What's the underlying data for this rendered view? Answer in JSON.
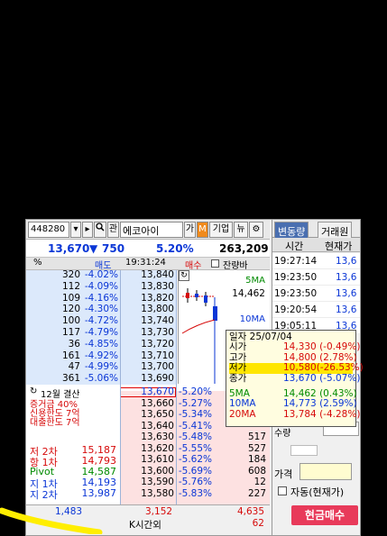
{
  "toolbar": {
    "code": "448280",
    "icon_search": "🔍",
    "kwan_label": "관",
    "name": "에코아이",
    "ga_label": "가",
    "m_label": "M",
    "company_label": "기업",
    "news_label": "뉴",
    "gear": "⚙"
  },
  "price": {
    "current": "13,670",
    "change_arrow": "▼",
    "change": "750",
    "pct": "5.20%",
    "volume": "263,209"
  },
  "header": {
    "percent_sign": "%",
    "sell": "매도",
    "time": "19:31:24",
    "buy": "매수",
    "remain": "잔량바"
  },
  "asks": [
    {
      "qty": "320",
      "pct": "-4.02%",
      "price": "13,840"
    },
    {
      "qty": "112",
      "pct": "-4.09%",
      "price": "13,830"
    },
    {
      "qty": "109",
      "pct": "-4.16%",
      "price": "13,820"
    },
    {
      "qty": "120",
      "pct": "-4.30%",
      "price": "13,800"
    },
    {
      "qty": "100",
      "pct": "-4.72%",
      "price": "13,740"
    },
    {
      "qty": "117",
      "pct": "-4.79%",
      "price": "13,730"
    },
    {
      "qty": "36",
      "pct": "-4.85%",
      "price": "13,720"
    },
    {
      "qty": "161",
      "pct": "-4.92%",
      "price": "13,710"
    },
    {
      "qty": "47",
      "pct": "-4.99%",
      "price": "13,700"
    },
    {
      "qty": "361",
      "pct": "-5.06%",
      "price": "13,690"
    }
  ],
  "bids": [
    {
      "price": "13,670",
      "pct": "-5.20%",
      "qty": ""
    },
    {
      "price": "13,660",
      "pct": "-5.27%",
      "qty": ""
    },
    {
      "price": "13,650",
      "pct": "-5.34%",
      "qty": ""
    },
    {
      "price": "13,640",
      "pct": "-5.41%",
      "qty": ""
    },
    {
      "price": "13,630",
      "pct": "-5.48%",
      "qty": "517"
    },
    {
      "price": "13,620",
      "pct": "-5.55%",
      "qty": "527"
    },
    {
      "price": "13,610",
      "pct": "-5.62%",
      "qty": "184"
    },
    {
      "price": "13,600",
      "pct": "-5.69%",
      "qty": "608"
    },
    {
      "price": "13,590",
      "pct": "-5.76%",
      "qty": "12"
    },
    {
      "price": "13,580",
      "pct": "-5.83%",
      "qty": "227"
    }
  ],
  "chart": {
    "ma5_label": "5MA",
    "ma5_value": "14,462",
    "ma10_label": "10MA"
  },
  "info": {
    "settle": "12월 결산",
    "margin": "증거금 40%",
    "credit": "신용한도 7억",
    "loan": "대출한도 7억",
    "res2_label": "저 2차",
    "res2": "15,187",
    "res1_label": "항 1차",
    "res1": "14,793",
    "pivot_label": "Pivot",
    "pivot": "14,587",
    "sup1_label": "지 1차",
    "sup1": "14,193",
    "sup2_label": "지 2차",
    "sup2": "13,987"
  },
  "footer": {
    "ask_total": "1,483",
    "diff": "3,152",
    "bid_total": "4,635",
    "after_hours_label": "K시간외",
    "after_hours_value": "62"
  },
  "right": {
    "tab1": "변동량",
    "tab2": "거래원",
    "col_time": "시간",
    "col_price": "현재가",
    "ticks": [
      {
        "time": "19:27:14",
        "price": "13,6"
      },
      {
        "time": "19:23:50",
        "price": "13,6"
      },
      {
        "time": "19:23:50",
        "price": "13,6"
      },
      {
        "time": "19:20:54",
        "price": "13,6"
      },
      {
        "time": "19:05:11",
        "price": "13,6"
      }
    ],
    "fragment": "수량",
    "price_label": "가격",
    "auto_label": "자동(현재가)",
    "cash_buy": "현금매수"
  },
  "popup": {
    "date_label": "일자",
    "date": "25/07/04",
    "open_label": "시가",
    "open": "14,330 (-0.49%)",
    "high_label": "고가",
    "high": "14,800 (2.78%)",
    "low_label": "저가",
    "low": "10,580(-26.53%)",
    "close_label": "종가",
    "close": "13,670 (-5.07%)",
    "ma5_label": "5MA",
    "ma5": "14,462 (0.43%)",
    "ma10_label": "10MA",
    "ma10": "14,773 (2.59%)",
    "ma20_label": "20MA",
    "ma20": "13,784 (-4.28%)"
  },
  "colors": {
    "ask_bg": "#dce9fb",
    "bid_bg": "#fde1e1",
    "up": "#d60a0a",
    "down": "#0a36d6",
    "highlight": "#ffe600",
    "cash_button": "#e83a5a"
  }
}
